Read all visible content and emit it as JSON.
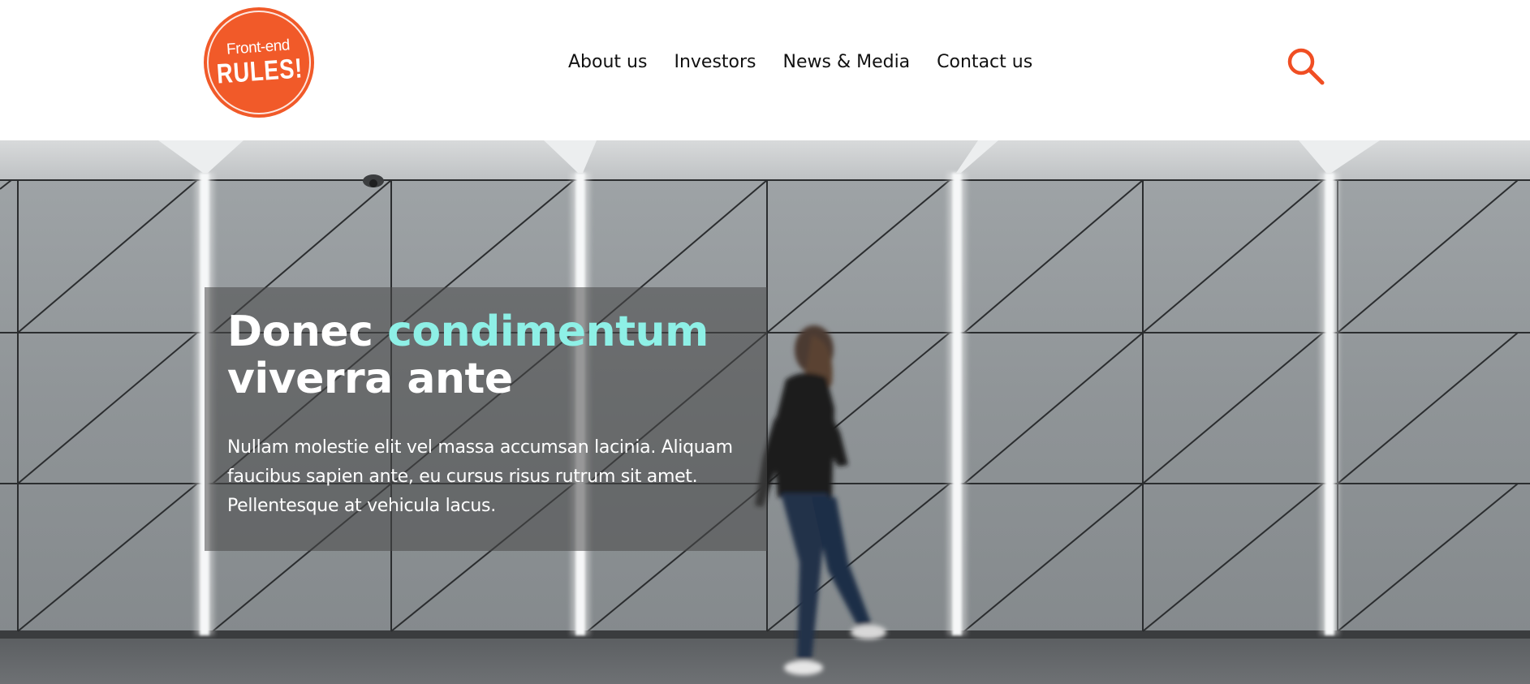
{
  "logo": {
    "line1": "Front-end",
    "line2": "RULES!",
    "color": "#f15a29"
  },
  "nav": {
    "items": [
      {
        "label": "About us"
      },
      {
        "label": "Investors"
      },
      {
        "label": "News & Media"
      },
      {
        "label": "Contact us"
      }
    ]
  },
  "search": {
    "icon": "search-icon",
    "color": "#f04e23"
  },
  "hero": {
    "title_part1": "Donec ",
    "title_accent": "condimentum",
    "title_part2": "viverra ante",
    "body": "Nullam molestie elit vel massa accumsan lacinia. Aliquam faucibus sapien ante, eu cursus risus rutrum sit amet. Pellentesque at vehicula lacus.",
    "accent_color": "#8ef0e6",
    "image": "person walking past grey paneled wall"
  }
}
